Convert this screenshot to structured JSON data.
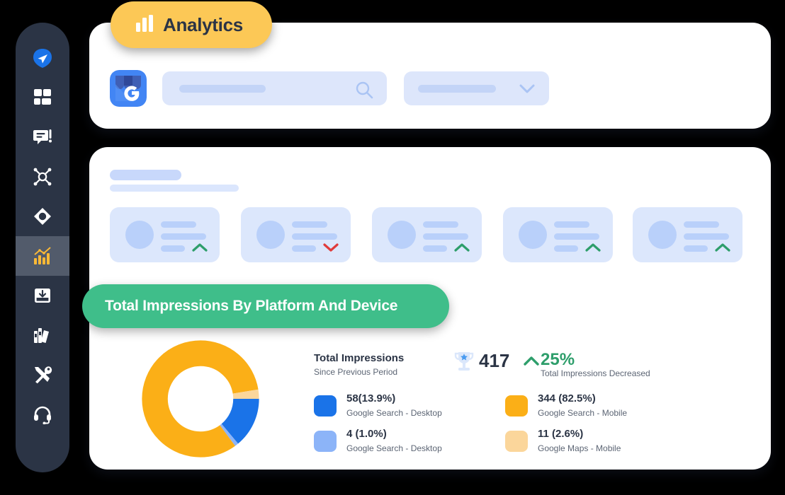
{
  "badge": {
    "label": "Analytics",
    "icon": "bar-chart-icon",
    "bg_color": "#fcc856"
  },
  "sidebar": {
    "bg_color": "#2b3445",
    "active_bg_color": "#525b6b",
    "items": [
      {
        "icon": "paper-plane-icon",
        "active": false
      },
      {
        "icon": "grid-dashboard-icon",
        "active": false
      },
      {
        "icon": "chat-alert-icon",
        "active": false
      },
      {
        "icon": "network-share-icon",
        "active": false
      },
      {
        "icon": "diamond-target-icon",
        "active": false
      },
      {
        "icon": "analytics-chart-icon",
        "active": true
      },
      {
        "icon": "inbox-download-icon",
        "active": false
      },
      {
        "icon": "library-books-icon",
        "active": false
      },
      {
        "icon": "tools-icon",
        "active": false
      },
      {
        "icon": "headset-support-icon",
        "active": false
      }
    ]
  },
  "top_card": {
    "source_icon": "google-my-business-icon",
    "search": {
      "placeholder": "",
      "value": "",
      "icon": "search-icon"
    },
    "select": {
      "value": "",
      "icon": "chevron-down-icon"
    }
  },
  "main_card": {
    "stat_cards": [
      {
        "trend": "up",
        "trend_color": "#2e9e6b"
      },
      {
        "trend": "down",
        "trend_color": "#e03b3b"
      },
      {
        "trend": "up",
        "trend_color": "#2e9e6b"
      },
      {
        "trend": "up",
        "trend_color": "#2e9e6b"
      },
      {
        "trend": "up",
        "trend_color": "#2e9e6b"
      }
    ]
  },
  "banner": {
    "title": "Total Impressions By Platform And Device",
    "bg_color": "#3fbe8a"
  },
  "summary": {
    "title": "Total Impressions",
    "subtitle": "Since Previous Period",
    "trophy_icon": "trophy-star-icon",
    "count": "417",
    "delta_icon": "chevron-up-icon",
    "delta": "25%",
    "delta_note": "Total Impressions Decreased",
    "delta_color": "#2e9e6b"
  },
  "chart_data": {
    "type": "pie",
    "title": "Total Impressions By Platform And Device",
    "total": 417,
    "categories": [
      "Google Search - Desktop",
      "Google Search - Desktop",
      "Google Search - Mobile",
      "Google Maps - Mobile"
    ],
    "values": [
      58,
      4,
      344,
      11
    ],
    "percents": [
      13.9,
      1.0,
      82.5,
      2.6
    ],
    "colors": [
      "#1a73e8",
      "#8cb4f8",
      "#fbaf17",
      "#fbd69b"
    ],
    "labels": [
      "58(13.9%)",
      "4 (1.0%)",
      "344 (82.5%)",
      "11 (2.6%)"
    ],
    "legend_position": "right",
    "donut": true
  },
  "legend": [
    {
      "value": "58(13.9%)",
      "label": "Google Search - Desktop",
      "color": "#1a73e8"
    },
    {
      "value": "4 (1.0%)",
      "label": "Google Search - Desktop",
      "color": "#8cb4f8"
    },
    {
      "value": "344 (82.5%)",
      "label": "Google Search - Mobile",
      "color": "#fbaf17"
    },
    {
      "value": "11 (2.6%)",
      "label": "Google Maps - Mobile",
      "color": "#fbd69b"
    }
  ]
}
